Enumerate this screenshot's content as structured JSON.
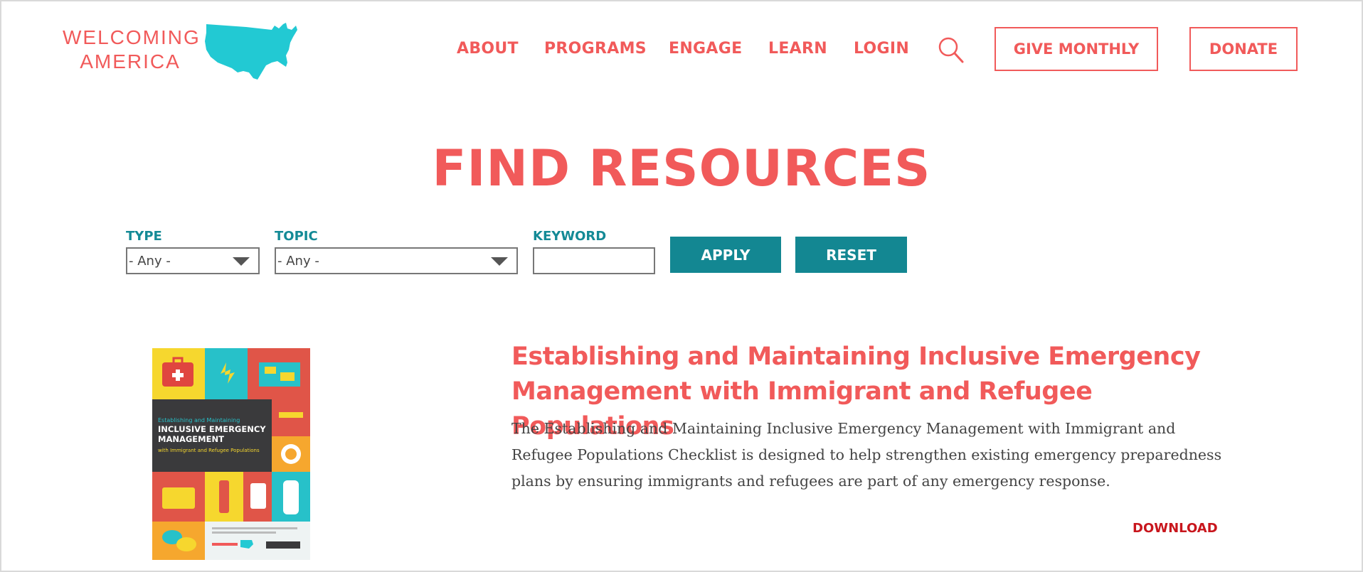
{
  "logo": {
    "line1": "WELCOMING",
    "line2": "AMERICA",
    "map_color": "#22c9d3"
  },
  "nav": {
    "items": [
      {
        "label": "ABOUT"
      },
      {
        "label": "PROGRAMS"
      },
      {
        "label": "ENGAGE"
      },
      {
        "label": "LEARN"
      },
      {
        "label": "LOGIN"
      }
    ],
    "search_icon": "search-icon",
    "give_monthly": "GIVE MONTHLY",
    "donate": "DONATE"
  },
  "page": {
    "title": "FIND RESOURCES"
  },
  "filters": {
    "type_label": "TYPE",
    "type_value": "- Any -",
    "topic_label": "TOPIC",
    "topic_value": "- Any -",
    "keyword_label": "KEYWORD",
    "keyword_value": "",
    "apply": "APPLY",
    "reset": "RESET"
  },
  "resource": {
    "title": "Establishing and Maintaining Inclusive Emergency Management with Immigrant and Refugee Populations",
    "description": "The Establishing and Maintaining Inclusive Emergency Management with Immigrant and Refugee Populations Checklist is designed to help strengthen existing emergency preparedness plans by ensuring immigrants and refugees are part of any emergency response.",
    "download": "DOWNLOAD",
    "cover": {
      "small_title": "Establishing and Maintaining",
      "big_title_1": "INCLUSIVE EMERGENCY",
      "big_title_2": "MANAGEMENT",
      "subtitle": "with Immigrant and Refugee Populations"
    }
  },
  "colors": {
    "accent": "#f15a5a",
    "teal": "#138792",
    "download": "#c8161d"
  }
}
